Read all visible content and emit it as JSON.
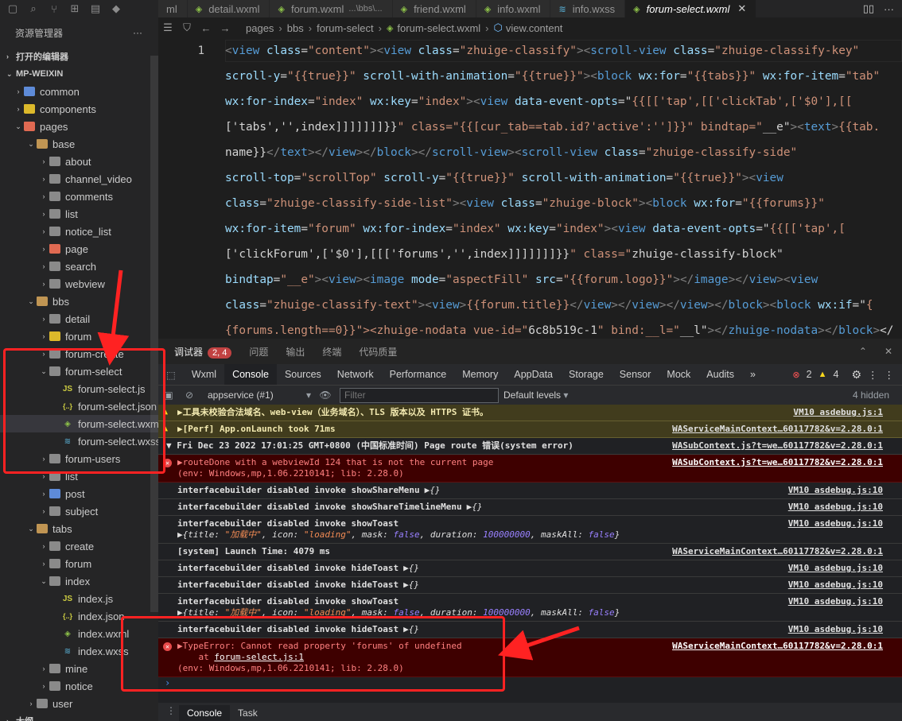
{
  "tabs": [
    {
      "label": "ml",
      "icon": ""
    },
    {
      "label": "detail.wxml",
      "icon": "wxml-file-icon"
    },
    {
      "label": "forum.wxml",
      "note": "...\\bbs\\...",
      "icon": "wxml-file-icon"
    },
    {
      "label": "friend.wxml",
      "icon": "wxml-file-icon"
    },
    {
      "label": "info.wxml",
      "icon": "wxml-file-icon"
    },
    {
      "label": "info.wxss",
      "icon": "wxss-file-icon"
    },
    {
      "label": "forum-select.wxml",
      "icon": "wxml-file-icon",
      "active": true
    }
  ],
  "explorer": {
    "title": "资源管理器",
    "more": "···",
    "open_editors": "打开的编辑器",
    "project": "MP-WEIXIN",
    "footer": "大纲",
    "tree": [
      {
        "label": "common",
        "depth": 0,
        "type": "folder",
        "color": "folder-b",
        "open": false
      },
      {
        "label": "components",
        "depth": 0,
        "type": "folder",
        "color": "folder-y",
        "open": false
      },
      {
        "label": "pages",
        "depth": 0,
        "type": "folder",
        "color": "folder-r",
        "open": true
      },
      {
        "label": "base",
        "depth": 1,
        "type": "folder",
        "color": "folder",
        "open": true
      },
      {
        "label": "about",
        "depth": 2,
        "type": "folder",
        "color": "folder-dim",
        "open": false
      },
      {
        "label": "channel_video",
        "depth": 2,
        "type": "folder",
        "color": "folder-dim",
        "open": false
      },
      {
        "label": "comments",
        "depth": 2,
        "type": "folder",
        "color": "folder-dim",
        "open": false
      },
      {
        "label": "list",
        "depth": 2,
        "type": "folder",
        "color": "folder-dim",
        "open": false
      },
      {
        "label": "notice_list",
        "depth": 2,
        "type": "folder",
        "color": "folder-dim",
        "open": false
      },
      {
        "label": "page",
        "depth": 2,
        "type": "folder",
        "color": "folder-r",
        "open": false
      },
      {
        "label": "search",
        "depth": 2,
        "type": "folder",
        "color": "folder-dim",
        "open": false
      },
      {
        "label": "webview",
        "depth": 2,
        "type": "folder",
        "color": "folder-dim",
        "open": false
      },
      {
        "label": "bbs",
        "depth": 1,
        "type": "folder",
        "color": "folder",
        "open": true
      },
      {
        "label": "detail",
        "depth": 2,
        "type": "folder",
        "color": "folder-dim",
        "open": false
      },
      {
        "label": "forum",
        "depth": 2,
        "type": "folder",
        "color": "folder-y",
        "open": false
      },
      {
        "label": "forum-create",
        "depth": 2,
        "type": "folder",
        "color": "folder-dim",
        "open": false
      },
      {
        "label": "forum-select",
        "depth": 2,
        "type": "folder",
        "color": "folder-dim",
        "open": true
      },
      {
        "label": "forum-select.js",
        "depth": 3,
        "type": "js"
      },
      {
        "label": "forum-select.json",
        "depth": 3,
        "type": "json"
      },
      {
        "label": "forum-select.wxml",
        "depth": 3,
        "type": "wxml",
        "selected": true
      },
      {
        "label": "forum-select.wxss",
        "depth": 3,
        "type": "wxss"
      },
      {
        "label": "forum-users",
        "depth": 2,
        "type": "folder",
        "color": "folder-dim",
        "open": false
      },
      {
        "label": "list",
        "depth": 2,
        "type": "folder",
        "color": "folder-dim",
        "open": false
      },
      {
        "label": "post",
        "depth": 2,
        "type": "folder",
        "color": "folder-b",
        "open": false
      },
      {
        "label": "subject",
        "depth": 2,
        "type": "folder",
        "color": "folder-dim",
        "open": false
      },
      {
        "label": "tabs",
        "depth": 1,
        "type": "folder",
        "color": "folder",
        "open": true
      },
      {
        "label": "create",
        "depth": 2,
        "type": "folder",
        "color": "folder-dim",
        "open": false
      },
      {
        "label": "forum",
        "depth": 2,
        "type": "folder",
        "color": "folder-dim",
        "open": false
      },
      {
        "label": "index",
        "depth": 2,
        "type": "folder",
        "color": "folder-dim",
        "open": true
      },
      {
        "label": "index.js",
        "depth": 3,
        "type": "js"
      },
      {
        "label": "index.json",
        "depth": 3,
        "type": "json"
      },
      {
        "label": "index.wxml",
        "depth": 3,
        "type": "wxml"
      },
      {
        "label": "index.wxss",
        "depth": 3,
        "type": "wxss"
      },
      {
        "label": "mine",
        "depth": 2,
        "type": "folder",
        "color": "folder-dim",
        "open": false
      },
      {
        "label": "notice",
        "depth": 2,
        "type": "folder",
        "color": "folder-dim",
        "open": false
      },
      {
        "label": "user",
        "depth": 1,
        "type": "folder",
        "color": "folder-dim",
        "open": false
      }
    ]
  },
  "breadcrumb": [
    "pages",
    "bbs",
    "forum-select",
    "forum-select.wxml",
    "view.content"
  ],
  "editor": {
    "line_number": "1",
    "lines": [
      "<view class=\"content\"><view class=\"zhuige-classify\"><scroll-view class=\"zhuige-classify-key\"",
      "scroll-y=\"{{true}}\" scroll-with-animation=\"{{true}}\"><block wx:for=\"{{tabs}}\" wx:for-item=\"tab\"",
      "wx:for-index=\"index\" wx:key=\"index\"><view data-event-opts=\"{{[['tap',[['clickTab',['$0'],[[",
      "['tabs','',index]]]]]]]}}\" class=\"{{[cur_tab==tab.id?'active':'']}}\" bindtap=\"__e\"><text>{{tab.",
      "name}}</text></view></block></scroll-view><scroll-view class=\"zhuige-classify-side\"",
      "scroll-top=\"scrollTop\" scroll-y=\"{{true}}\" scroll-with-animation=\"{{true}}\"><view",
      "class=\"zhuige-classify-side-list\"><view class=\"zhuige-block\"><block wx:for=\"{{forums}}\"",
      "wx:for-item=\"forum\" wx:for-index=\"index\" wx:key=\"index\"><view data-event-opts=\"{{[['tap',[",
      "['clickForum',['$0'],[[['forums','',index]]]]]]]}}\" class=\"zhuige-classify-block\"",
      "bindtap=\"__e\"><view><image mode=\"aspectFill\" src=\"{{forum.logo}}\"></image></view><view",
      "class=\"zhuige-classify-text\"><view>{{forum.title}}</view></view></view></block><block wx:if=\"{",
      "{forums.length==0}}\"><zhuige-nodata vue-id=\"6c8b519c-1\" bind:__l=\"__l\"></zhuige-nodata></block></"
    ]
  },
  "panel": {
    "tabs": [
      "调试器",
      "问题",
      "输出",
      "终端",
      "代码质量"
    ],
    "badge": "2, 4",
    "devtools_tabs": [
      "Wxml",
      "Console",
      "Sources",
      "Network",
      "Performance",
      "Memory",
      "AppData",
      "Storage",
      "Sensor",
      "Mock",
      "Audits"
    ],
    "more": "»",
    "err_count": "2",
    "warn_count": "4",
    "context": "appservice (#1)",
    "filter_placeholder": "Filter",
    "levels": "Default levels",
    "hidden": "4 hidden",
    "bottom_tabs": [
      "Console",
      "Task"
    ]
  },
  "console": [
    {
      "kind": "warn",
      "text": "▶工具未校验合法域名、web-view（业务域名）、TLS 版本以及 HTTPS 证书。",
      "src": "VM10 asdebug.js:1"
    },
    {
      "kind": "warn",
      "text": "▶[Perf] App.onLaunch took 71ms",
      "src": "WAServiceMainContext…60117782&v=2.28.0:1"
    },
    {
      "kind": "group",
      "text": "▼ Fri Dec 23 2022 17:01:25 GMT+0800 (中国标准时间) Page route 错误(system error)",
      "src": "WASubContext.js?t=we…60117782&v=2.28.0:1"
    },
    {
      "kind": "err",
      "text": "▶routeDone with a webviewId 124 that is not the current page",
      "text2": "(env: Windows,mp,1.06.2210141; lib: 2.28.0)",
      "src": "WASubContext.js?t=we…60117782&v=2.28.0:1"
    },
    {
      "kind": "log",
      "text": "interfacebuilder disabled invoke showShareMenu",
      "obj": "▶{}",
      "src": "VM10 asdebug.js:10"
    },
    {
      "kind": "log",
      "text": "interfacebuilder disabled invoke showShareTimelineMenu",
      "obj": "▶{}",
      "src": "VM10 asdebug.js:10"
    },
    {
      "kind": "log2",
      "text": "interfacebuilder disabled invoke showToast",
      "src": "VM10 asdebug.js:10"
    },
    {
      "kind": "log",
      "text": "[system] Launch Time: 4079 ms",
      "src": "WAServiceMainContext…60117782&v=2.28.0:1"
    },
    {
      "kind": "log",
      "text": "interfacebuilder disabled invoke hideToast",
      "obj": "▶{}",
      "src": "VM10 asdebug.js:10"
    },
    {
      "kind": "log",
      "text": "interfacebuilder disabled invoke hideToast",
      "obj": "▶{}",
      "src": "VM10 asdebug.js:10"
    },
    {
      "kind": "log2",
      "text": "interfacebuilder disabled invoke showToast",
      "src": "VM10 asdebug.js:10"
    },
    {
      "kind": "log",
      "text": "interfacebuilder disabled invoke hideToast",
      "obj": "▶{}",
      "src": "VM10 asdebug.js:10"
    },
    {
      "kind": "err3",
      "text": "▶TypeError: Cannot read property 'forums' of undefined",
      "at": "    at ",
      "atlink": "forum-select.js:1",
      "text2": "(env: Windows,mp,1.06.2210141; lib: 2.28.0)",
      "src": "WAServiceMainContext…60117782&v=2.28.0:1"
    }
  ],
  "toast_obj": {
    "prefix": "▶{",
    "title_key": "title",
    "title_val": "\"加载中\"",
    "icon_key": "icon",
    "icon_val": "\"loading\"",
    "mask_key": "mask",
    "mask_val": "false",
    "dur_key": "duration",
    "dur_val": "100000000",
    "maskall_key": "maskAll",
    "maskall_val": "false",
    "suffix": "}"
  },
  "prompt": "›",
  "colors": {
    "annotation": "#ff2222",
    "error_bg": "#3e0000",
    "warn_bg": "#413c1d",
    "accent": "#007acc"
  }
}
